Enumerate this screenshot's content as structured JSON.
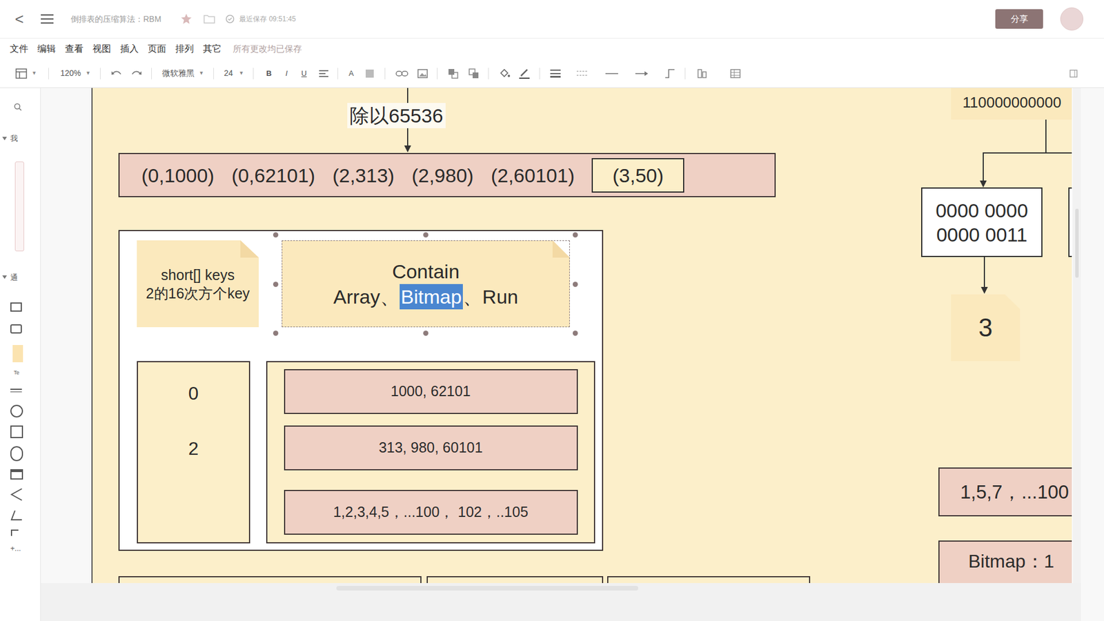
{
  "header": {
    "back": "<",
    "title": "倒排表的压缩算法：RBM",
    "save_status": "最近保存 09:51:45",
    "share": "分享"
  },
  "menubar": {
    "items": [
      "文件",
      "编辑",
      "查看",
      "视图",
      "插入",
      "页面",
      "排列",
      "其它"
    ],
    "status": "所有更改均已保存"
  },
  "toolbar": {
    "zoom": "120%",
    "font": "微软雅黑",
    "font_size": "24",
    "bold": "B",
    "italic": "I",
    "underline": "U",
    "font_color": "A"
  },
  "sidebar": {
    "sections": [
      {
        "label": "我",
        "expanded": true
      },
      {
        "label": "通",
        "expanded": true
      }
    ],
    "text_shape": "Te",
    "more": "+..."
  },
  "canvas": {
    "divide_label": "除以65536",
    "pairs": [
      {
        "label": "(0,1000)",
        "highlighted": false
      },
      {
        "label": "(0,62101)",
        "highlighted": false
      },
      {
        "label": "(2,313)",
        "highlighted": false
      },
      {
        "label": "(2,980)",
        "highlighted": false
      },
      {
        "label": "(2,60101)",
        "highlighted": false
      },
      {
        "label": "(3,50)",
        "highlighted": true
      }
    ],
    "container": {
      "keys_note": [
        "short[] keys",
        "2的16次方个key"
      ],
      "contain_note": {
        "title": "Contain",
        "separator": "、",
        "selected": true,
        "types": [
          {
            "label": "Array",
            "selected": false
          },
          {
            "label": "Bitmap",
            "selected": true
          },
          {
            "label": "Run",
            "selected": false
          }
        ]
      },
      "keys": [
        "0",
        "2"
      ],
      "containers": [
        "1000, 62101",
        "313, 980, 60101",
        "1,2,3,4,5，...100， 102，..105"
      ]
    },
    "binary": "110000000000",
    "high_bits": [
      "0000 0000",
      "0000 0011"
    ],
    "result": "3",
    "values": "1,5,7，...100",
    "bitmap": "Bitmap：1"
  }
}
